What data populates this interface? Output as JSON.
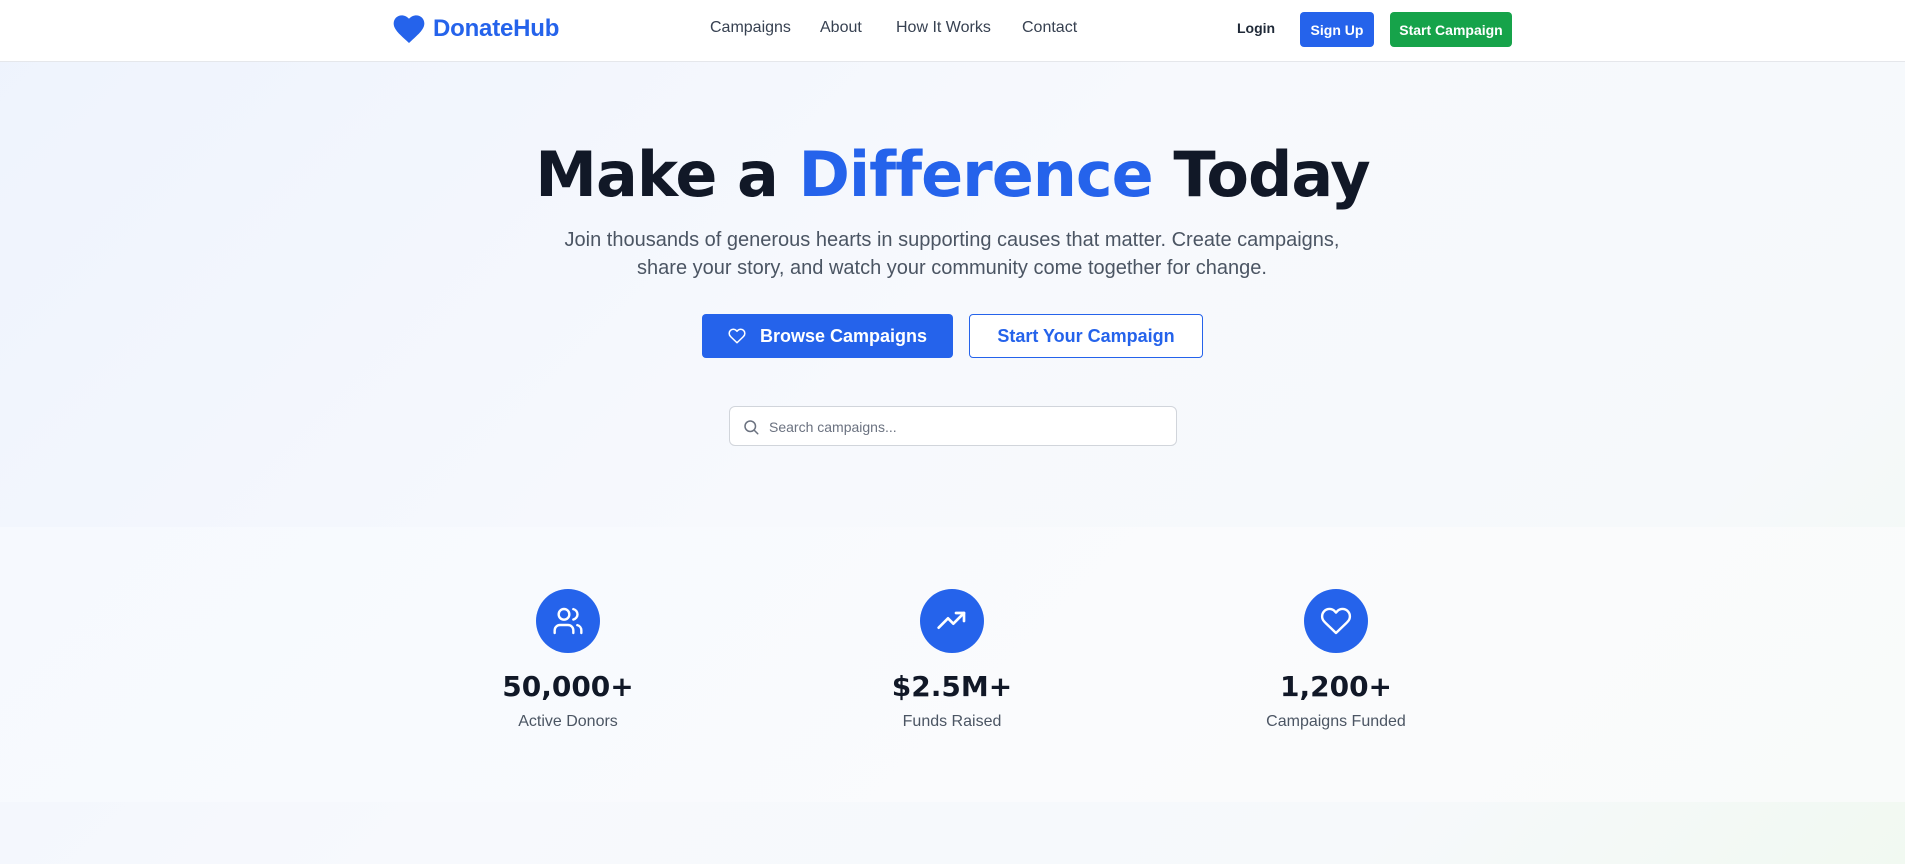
{
  "header": {
    "logo_text": "DonateHub",
    "nav": [
      "Campaigns",
      "About",
      "How It Works",
      "Contact"
    ],
    "login_label": "Login",
    "signup_label": "Sign Up",
    "start_campaign_label": "Start Campaign"
  },
  "hero": {
    "title_part1": "Make a",
    "title_accent": "Difference",
    "title_part2": "Today",
    "subtitle_line1": "Join thousands of generous hearts in supporting causes that matter. Create campaigns,",
    "subtitle_line2": "share your story, and watch your community come together for change.",
    "browse_label": "Browse Campaigns",
    "start_yours_label": "Start Your Campaign",
    "search_placeholder": "Search campaigns..."
  },
  "stats": [
    {
      "icon": "users-icon",
      "value": "50,000+",
      "label": "Active Donors"
    },
    {
      "icon": "trending-up-icon",
      "value": "$2.5M+",
      "label": "Funds Raised"
    },
    {
      "icon": "heart-icon",
      "value": "1,200+",
      "label": "Campaigns Funded"
    }
  ],
  "colors": {
    "primary": "#2563eb",
    "success": "#16a34a",
    "heading": "#111827",
    "muted": "#4b5563"
  }
}
